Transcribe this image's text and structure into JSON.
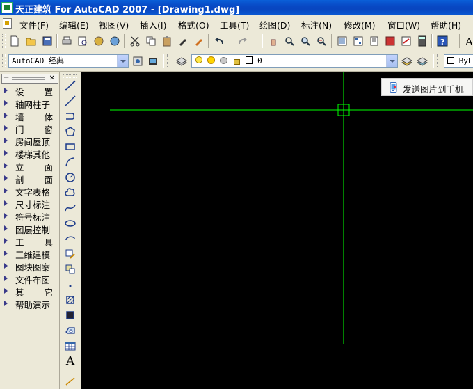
{
  "window": {
    "title": "天正建筑 For AutoCAD 2007 - [Drawing1.dwg]"
  },
  "menu": [
    {
      "label": "文件(F)"
    },
    {
      "label": "编辑(E)"
    },
    {
      "label": "视图(V)"
    },
    {
      "label": "插入(I)"
    },
    {
      "label": "格式(O)"
    },
    {
      "label": "工具(T)"
    },
    {
      "label": "绘图(D)"
    },
    {
      "label": "标注(N)"
    },
    {
      "label": "修改(M)"
    },
    {
      "label": "窗口(W)"
    },
    {
      "label": "帮助(H)"
    }
  ],
  "toolbar2": {
    "workspace": "AutoCAD 经典",
    "layer": "0",
    "color": "ByLa"
  },
  "palette": {
    "items": [
      {
        "label": "设置"
      },
      {
        "label": "轴网柱子"
      },
      {
        "label": "墙体"
      },
      {
        "label": "门窗"
      },
      {
        "label": "房间屋顶"
      },
      {
        "label": "楼梯其他"
      },
      {
        "label": "立面"
      },
      {
        "label": "剖面"
      },
      {
        "label": "文字表格"
      },
      {
        "label": "尺寸标注"
      },
      {
        "label": "符号标注"
      },
      {
        "label": "图层控制"
      },
      {
        "label": "工具"
      },
      {
        "label": "三维建模"
      },
      {
        "label": "图块图案"
      },
      {
        "label": "文件布图"
      },
      {
        "label": "其它"
      },
      {
        "label": "帮助演示"
      }
    ]
  },
  "drawbar": {
    "text_tool": "A"
  },
  "popup": {
    "label": "发送图片到手机"
  },
  "colors": {
    "crosshair": "#00ff00",
    "canvas": "#000000",
    "titlebar": "#0a5fd8"
  }
}
